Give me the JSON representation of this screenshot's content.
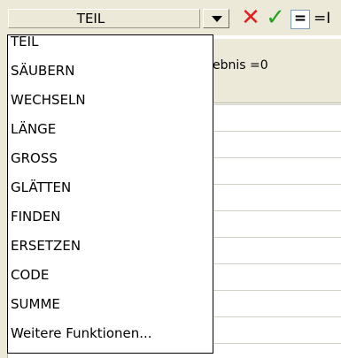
{
  "formula_bar": {
    "name_box_value": "TEIL",
    "cancel_icon": "x-icon",
    "enter_icon": "check-icon",
    "insert_function_label": "=",
    "formula_text": "=I",
    "colors": {
      "cancel": "#e02020",
      "enter": "#21a321"
    }
  },
  "sheet": {
    "hint_text": "ebnis =0"
  },
  "dropdown": {
    "items": [
      "TEIL",
      "SÄUBERN",
      "WECHSELN",
      "LÄNGE",
      "GROSS",
      "GLÄTTEN",
      "FINDEN",
      "ERSETZEN",
      "CODE",
      "SUMME",
      "Weitere Funktionen..."
    ]
  }
}
